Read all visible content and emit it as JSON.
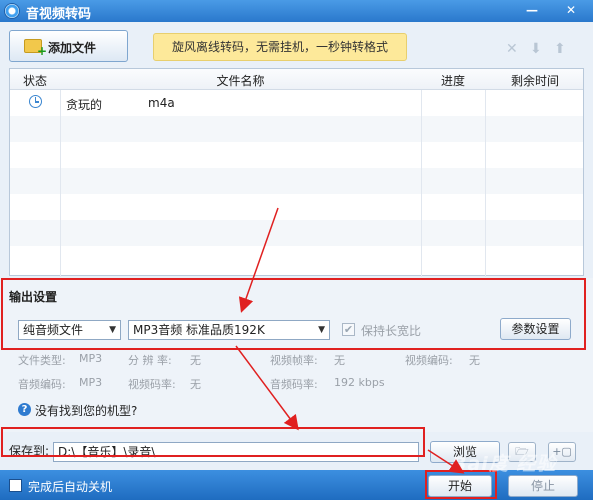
{
  "window": {
    "title": "音视频转码",
    "controls": {
      "close": "✕",
      "minimize": "—"
    }
  },
  "toolbar": {
    "add_file_label": "添加文件",
    "promo_text": "旋风离线转码，无需挂机，一秒钟转格式",
    "delete_icon": "✕",
    "move_down_icon": "⬇",
    "move_up_icon": "⬆"
  },
  "table": {
    "headers": {
      "status": "状态",
      "filename": "文件名称",
      "progress": "进度",
      "remaining": "剩余时间"
    },
    "rows": [
      {
        "status_icon": "clock-icon",
        "name": "贪玩的",
        "ext": "m4a",
        "progress": "",
        "remaining": ""
      }
    ]
  },
  "output": {
    "section_title": "输出设置",
    "format_type": "纯音频文件",
    "preset": "MP3音频 标准品质192K",
    "keep_aspect_label": "保持长宽比",
    "keep_aspect_mark": "✔",
    "params_button": "参数设置",
    "info": {
      "file_type_label": "文件类型:",
      "file_type_value": "MP3",
      "resolution_label": "分 辨 率:",
      "resolution_value": "无",
      "video_fps_label": "视频帧率:",
      "video_fps_value": "无",
      "video_codec_label": "视频编码:",
      "video_codec_value": "无",
      "audio_codec_label": "音频编码:",
      "audio_codec_value": "MP3",
      "video_bitrate_label": "视频码率:",
      "video_bitrate_value": "无",
      "audio_bitrate_label": "音频码率:",
      "audio_bitrate_value": "192 kbps"
    },
    "help_mark": "?",
    "help_text": "没有找到您的机型?"
  },
  "save": {
    "label": "保存到:",
    "path": "D:\\【音乐】\\录音\\",
    "browse": "浏览",
    "open_folder_icon": "🗁",
    "add_icon": "+▢"
  },
  "footer": {
    "auto_shutdown_label": "完成后自动关机",
    "start": "开始",
    "stop": "停止"
  },
  "watermark": "Bai度 经验",
  "colors": {
    "accent": "#2d7fd0",
    "annotation_red": "#e02020",
    "promo_bg": "#fde99a"
  }
}
